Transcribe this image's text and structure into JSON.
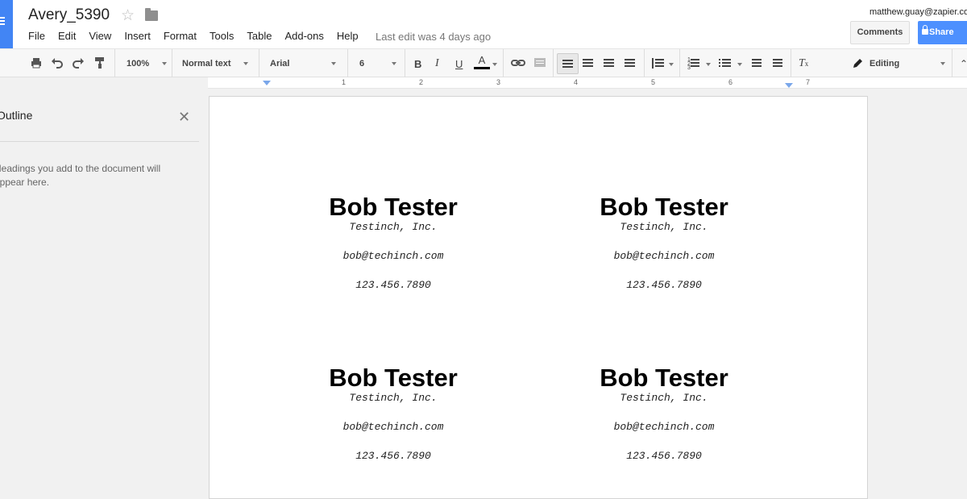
{
  "header": {
    "doc_title": "Avery_5390",
    "last_edit": "Last edit was 4 days ago",
    "user_email": "matthew.guay@zapier.com",
    "comments_label": "Comments",
    "share_label": "Share"
  },
  "menu": [
    "File",
    "Edit",
    "View",
    "Insert",
    "Format",
    "Tools",
    "Table",
    "Add-ons",
    "Help"
  ],
  "toolbar": {
    "zoom": "100%",
    "style": "Normal text",
    "font": "Arial",
    "size": "6",
    "mode": "Editing"
  },
  "ruler": {
    "labels": [
      "1",
      "2",
      "3",
      "4",
      "5",
      "6",
      "7"
    ]
  },
  "outline": {
    "title": "Outline",
    "hint": "Headings you add to the document will appear here."
  },
  "cards": [
    {
      "name": "Bob Tester",
      "company": "Testinch, Inc.",
      "email": "bob@techinch.com",
      "phone": "123.456.7890"
    },
    {
      "name": "Bob Tester",
      "company": "Testinch, Inc.",
      "email": "bob@techinch.com",
      "phone": "123.456.7890"
    },
    {
      "name": "Bob Tester",
      "company": "Testinch, Inc.",
      "email": "bob@techinch.com",
      "phone": "123.456.7890"
    },
    {
      "name": "Bob Tester",
      "company": "Testinch, Inc.",
      "email": "bob@techinch.com",
      "phone": "123.456.7890"
    }
  ],
  "colors": {
    "accent": "#4285f4",
    "share_button": "#4d90fe"
  }
}
